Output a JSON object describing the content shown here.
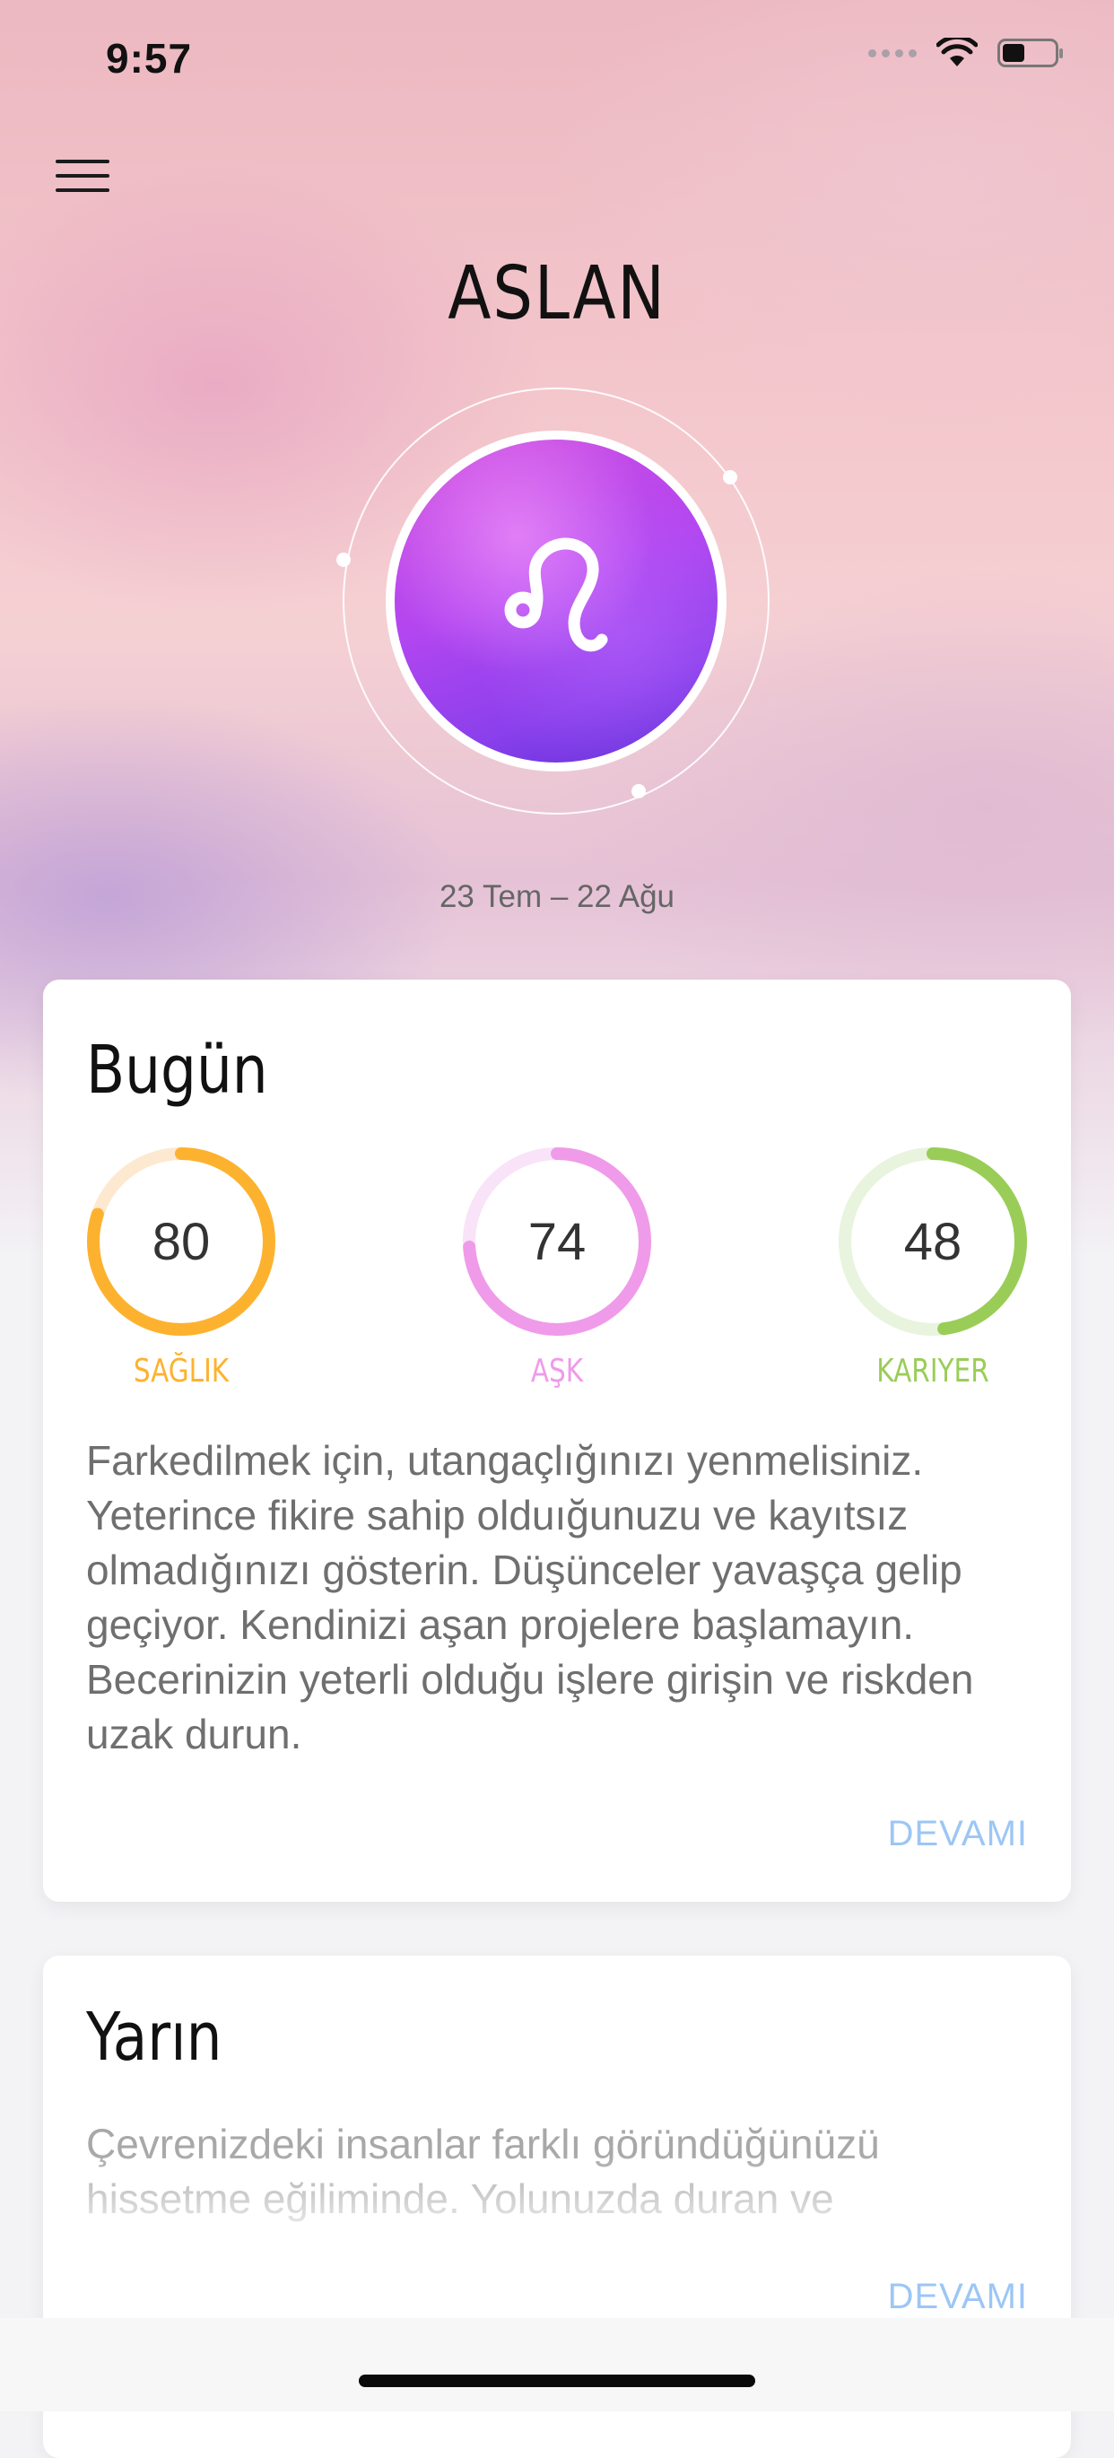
{
  "status_bar": {
    "time": "9:57"
  },
  "header": {
    "menu_icon": "hamburger-menu-icon",
    "sign_name": "ASLAN",
    "sign_icon": "leo-zodiac-icon",
    "date_range": "23 Tem – 22 Ağu"
  },
  "today": {
    "title": "Bugün",
    "gauges": [
      {
        "label": "SAĞLIK",
        "value": 80,
        "color": "#fdb22f",
        "track": "#fde9cf"
      },
      {
        "label": "AŞK",
        "value": 74,
        "color": "#ef9be9",
        "track": "#f9e3f8"
      },
      {
        "label": "KARIYER",
        "value": 48,
        "color": "#9acd57",
        "track": "#e8f4dd"
      }
    ],
    "text": "Farkedilmek için, utangaçlığınızı yenmelisiniz. Yeterince fikire sahip olduığunuzu ve kayıtsız olmadığınızı gösterin. Düşünceler yavaşça gelip geçiyor. Kendinizi aşan projelere başlamayın. Becerinizin yeterli olduğu işlere girişin ve riskden uzak durun.",
    "more_label": "DEVAMI"
  },
  "tomorrow": {
    "title": "Yarın",
    "text": "Çevrenizdeki insanlar farklı göründüğünüzü hissetme eğiliminde. Yolunuzda duran ve",
    "more_label": "DEVAMI"
  },
  "colors": {
    "accent_link": "#9cc6f5",
    "sign_purple": "#a845ea"
  }
}
